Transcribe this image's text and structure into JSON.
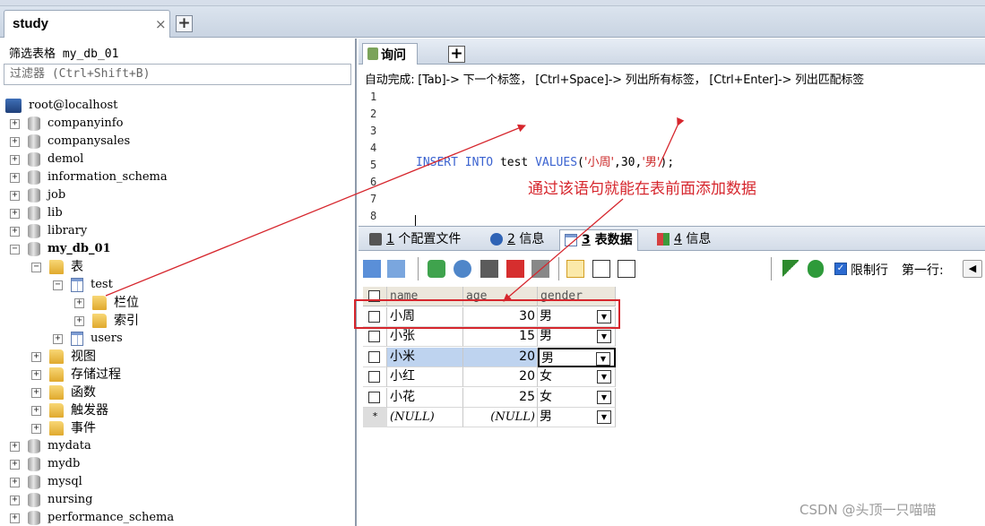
{
  "window": {
    "tab_title": "study",
    "tab_close": "×",
    "tab_add": "+"
  },
  "sidebar": {
    "filter_label": "筛选表格 my_db_01",
    "filter_placeholder": "过滤器 (Ctrl+Shift+B)",
    "tree": {
      "root": "root@localhost",
      "dbs_before": [
        "companyinfo",
        "companysales",
        "demol",
        "information_schema",
        "job",
        "lib",
        "library"
      ],
      "active_db": "my_db_01",
      "tables_folder": "表",
      "table_test": "test",
      "columns_folder": "栏位",
      "indexes_folder": "索引",
      "table_users": "users",
      "folders_after": [
        "视图",
        "存储过程",
        "函数",
        "触发器",
        "事件"
      ],
      "dbs_after": [
        "mydata",
        "mydb",
        "mysql",
        "nursing",
        "performance_schema"
      ]
    },
    "expand_open": "−",
    "expand_closed": "+"
  },
  "query": {
    "tab_label": "询问",
    "tab_add": "+",
    "autocomplete_hint": "自动完成: [Tab]-> 下一个标签， [Ctrl+Space]-> 列出所有标签， [Ctrl+Enter]-> 列出匹配标签",
    "line_numbers": [
      "1",
      "2",
      "3",
      "4",
      "5",
      "6",
      "7",
      "8"
    ],
    "sql": {
      "kw1": "INSERT",
      "kw2": "INTO",
      "table": "test",
      "kw3": "VALUES",
      "open": "(",
      "v1": "'小周'",
      "comma1": ",",
      "v2": "30",
      "comma2": ",",
      "v3": "'男'",
      "close": ");"
    }
  },
  "results": {
    "tabs": [
      {
        "num": "1",
        "label": "个配置文件"
      },
      {
        "num": "2",
        "label": "信息"
      },
      {
        "num": "3",
        "label": "表数据"
      },
      {
        "num": "4",
        "label": "信息"
      }
    ],
    "limit_label": "限制行",
    "first_row_label": "第一行:",
    "check_mark": "✓",
    "prev": "◀"
  },
  "grid": {
    "columns": [
      "name",
      "age",
      "gender"
    ],
    "rows": [
      {
        "name": "小周",
        "age": "30",
        "gender": "男"
      },
      {
        "name": "小张",
        "age": "15",
        "gender": "男"
      },
      {
        "name": "小米",
        "age": "20",
        "gender": "男"
      },
      {
        "name": "小红",
        "age": "20",
        "gender": "女"
      },
      {
        "name": "小花",
        "age": "25",
        "gender": "女"
      }
    ],
    "new_row": {
      "marker": "*",
      "name": "(NULL)",
      "age": "(NULL)",
      "gender": "男"
    },
    "dropdown": "▼"
  },
  "annotation": {
    "text": "通过该语句就能在表前面添加数据",
    "color": "#d6262d"
  },
  "watermark": "CSDN @头顶一只喵喵"
}
